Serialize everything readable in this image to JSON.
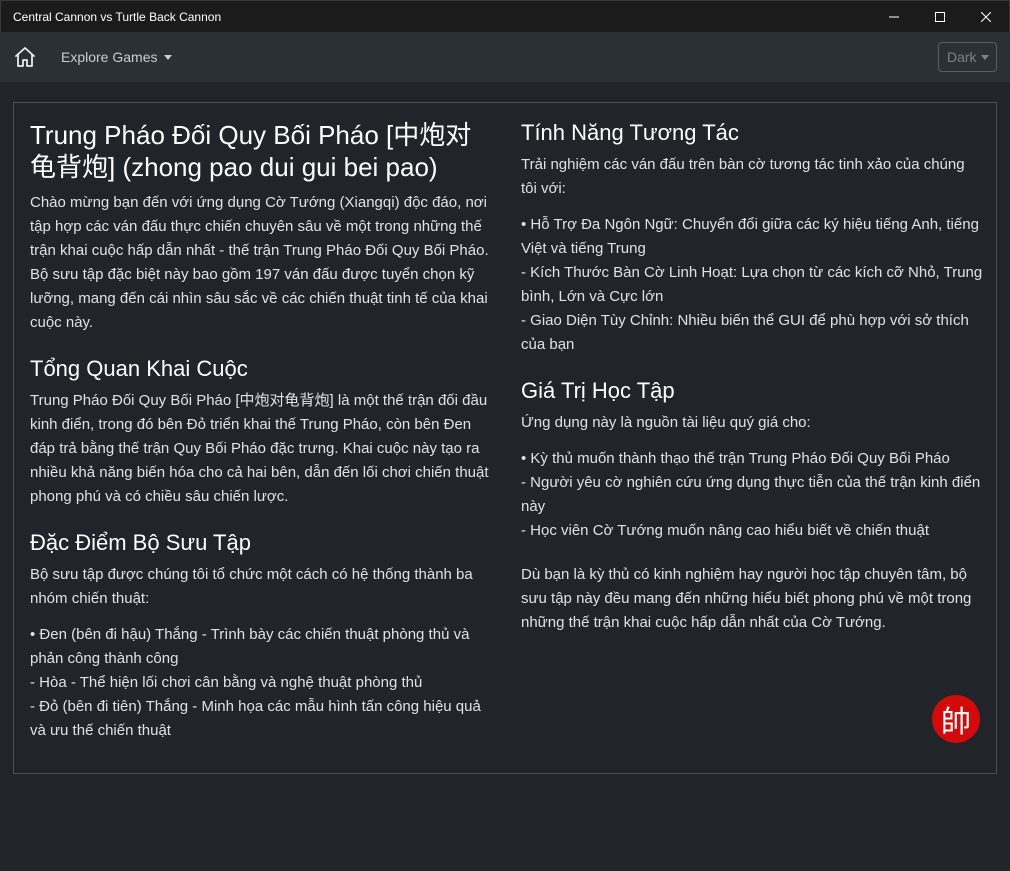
{
  "window": {
    "title": "Central Cannon vs Turtle Back Cannon",
    "controls": [
      "minimize-icon",
      "maximize-icon",
      "close-icon"
    ]
  },
  "navbar": {
    "home_icon": "home-icon",
    "explore_label": "Explore Games",
    "theme_value": "Dark"
  },
  "left": {
    "title": "Trung Pháo Đối Quy Bối Pháo [中炮对龟背炮] (zhong pao dui gui bei pao)",
    "intro": "Chào mừng bạn đến với ứng dụng Cờ Tướng (Xiangqi) độc đáo, nơi tập hợp các ván đấu thực chiến chuyên sâu về một trong những thế trận khai cuộc hấp dẫn nhất - thế trận Trung Pháo Đối Quy Bối Pháo. Bộ sưu tập đặc biệt này bao gồm 197 ván đấu được tuyển chọn kỹ lưỡng, mang đến cái nhìn sâu sắc về các chiến thuật tinh tế của khai cuộc này.",
    "overview_heading": "Tổng Quan Khai Cuộc",
    "overview_text": "Trung Pháo Đối Quy Bối Pháo [中炮对龟背炮] là một thế trận đối đầu kinh điển, trong đó bên Đỏ triển khai thế Trung Pháo, còn bên Đen đáp trả bằng thế trận Quy Bối Pháo đặc trưng. Khai cuộc này tạo ra nhiều khả năng biến hóa cho cả hai bên, dẫn đến lối chơi chiến thuật phong phú và có chiều sâu chiến lược.",
    "collection_heading": "Đặc Điểm Bộ Sưu Tập",
    "collection_text": "Bộ sưu tập được chúng tôi tổ chức một cách có hệ thống thành ba nhóm chiến thuật:",
    "collection_items": [
      "• Đen (bên đi hậu) Thắng - Trình bày các chiến thuật phòng thủ và phản công thành công",
      "- Hòa - Thể hiện lối chơi cân bằng và nghệ thuật phòng thủ",
      "- Đỏ (bên đi tiên) Thắng - Minh họa các mẫu hình tấn công hiệu quả và ưu thế chiến thuật"
    ]
  },
  "right": {
    "features_heading": "Tính Năng Tương Tác",
    "features_text": "Trải nghiệm các ván đấu trên bàn cờ tương tác tinh xảo của chúng tôi với:",
    "features_items": [
      "• Hỗ Trợ Đa Ngôn Ngữ: Chuyển đổi giữa các ký hiệu tiếng Anh, tiếng Việt và tiếng Trung",
      "- Kích Thước Bàn Cờ Linh Hoạt: Lựa chọn từ các kích cỡ Nhỏ, Trung bình, Lớn và Cực lớn",
      "- Giao Diện Tùy Chỉnh: Nhiều biến thể GUI để phù hợp với sở thích của bạn"
    ],
    "value_heading": "Giá Trị Học Tập",
    "value_text": "Ứng dụng này là nguồn tài liệu quý giá cho:",
    "value_items": [
      "• Kỳ thủ muốn thành thạo thế trận Trung Pháo Đối Quy Bối Pháo",
      "- Người yêu cờ nghiên cứu ứng dụng thực tiễn của thế trận kinh điển này",
      "- Học viên Cờ Tướng muốn nâng cao hiểu biết về chiến thuật"
    ],
    "closing": "Dù bạn là kỳ thủ có kinh nghiệm hay người học tập chuyên tâm, bộ sưu tập này đều mang đến những hiểu biết phong phú về một trong những thế trận khai cuộc hấp dẫn nhất của Cờ Tướng."
  },
  "seal": {
    "glyph": "帥",
    "color": "#d10b0b"
  }
}
